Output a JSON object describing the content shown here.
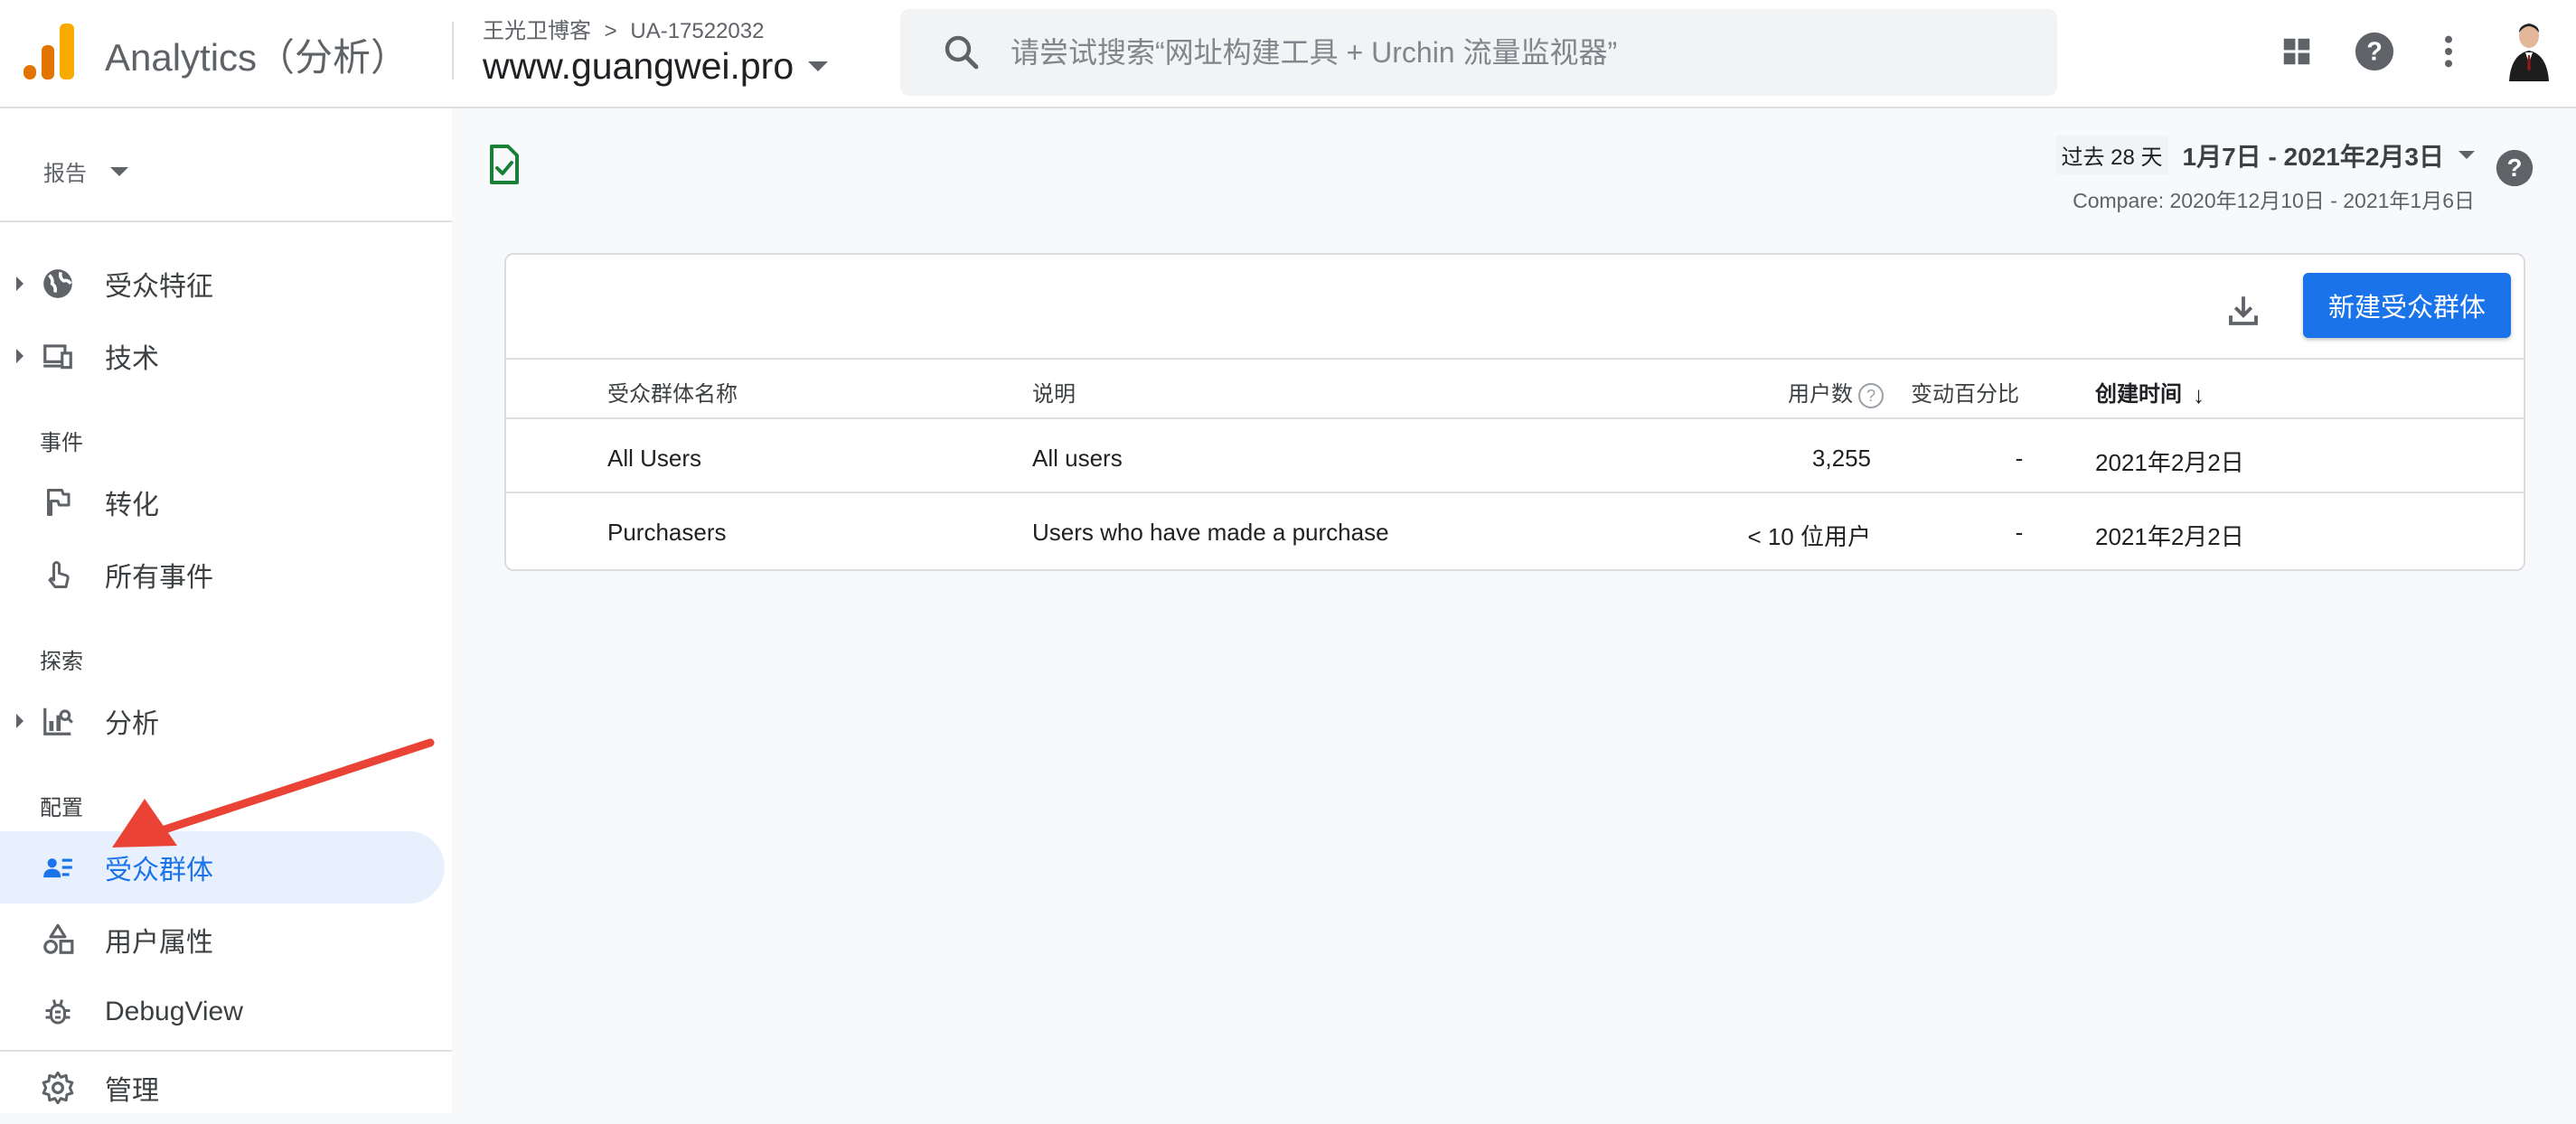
{
  "header": {
    "app_title": "Analytics（分析）",
    "breadcrumb": {
      "account": "王光卫博客",
      "separator": ">",
      "property_id": "UA-17522032"
    },
    "property_name": "www.guangwei.pro",
    "search_placeholder": "请尝试搜索“网址构建工具 + Urchin 流量监视器”",
    "logo_colors": [
      "#f9ab00",
      "#e37400",
      "#e37400"
    ]
  },
  "sidebar": {
    "report_label": "报告",
    "items_group1": [
      {
        "label": "受众特征",
        "icon": "globe-icon"
      },
      {
        "label": "技术",
        "icon": "devices-icon"
      }
    ],
    "section_events": "事件",
    "items_events": [
      {
        "label": "转化",
        "icon": "flag-icon"
      },
      {
        "label": "所有事件",
        "icon": "touch-icon"
      }
    ],
    "section_explore": "探索",
    "items_explore": [
      {
        "label": "分析",
        "icon": "analysis-icon"
      }
    ],
    "section_config": "配置",
    "items_config": [
      {
        "label": "受众群体",
        "icon": "audience-icon",
        "active": true
      },
      {
        "label": "用户属性",
        "icon": "shapes-icon"
      },
      {
        "label": "DebugView",
        "icon": "bug-icon"
      }
    ],
    "admin_label": "管理"
  },
  "date_range": {
    "last_days": "过去 28 天",
    "range": "1月7日 - 2021年2月3日",
    "compare": "Compare: 2020年12月10日 - 2021年1月6日"
  },
  "card": {
    "new_button": "新建受众群体",
    "columns": {
      "name": "受众群体名称",
      "description": "说明",
      "users": "用户数",
      "users_help": "?",
      "change": "变动百分比",
      "created": "创建时间",
      "sort_indicator": "↓"
    },
    "rows": [
      {
        "name": "All Users",
        "description": "All users",
        "users": "3,255",
        "change": "-",
        "created": "2021年2月2日"
      },
      {
        "name": "Purchasers",
        "description": "Users who have made a purchase",
        "users": "< 10 位用户",
        "change": "-",
        "created": "2021年2月2日"
      }
    ]
  },
  "colors": {
    "accent": "#1a73e8",
    "active_bg": "#e8f0fe",
    "annotation_arrow": "#ea4335"
  }
}
